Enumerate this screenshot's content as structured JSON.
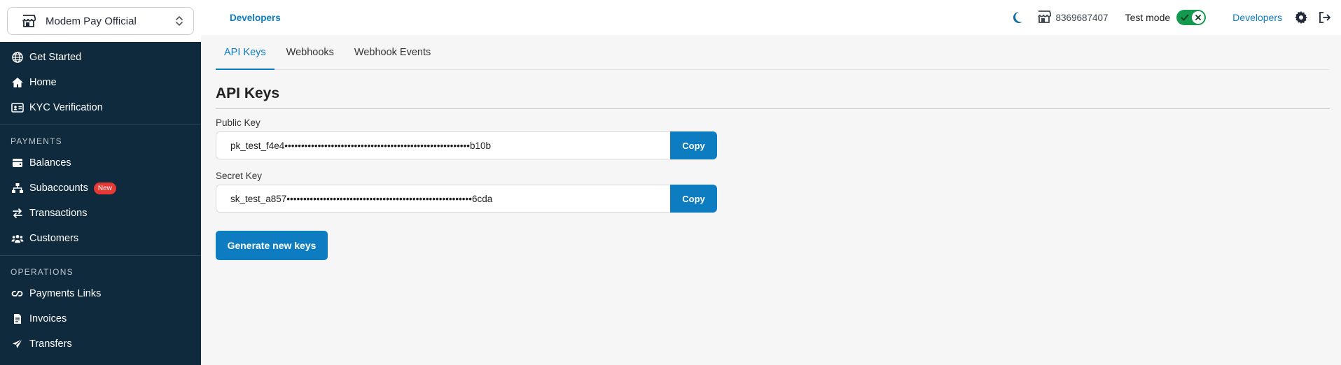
{
  "store": {
    "name": "Modem Pay Official"
  },
  "sidebar": {
    "top_items": [
      {
        "label": "Get Started",
        "icon": "globe-icon"
      },
      {
        "label": "Home",
        "icon": "home-icon"
      },
      {
        "label": "KYC Verification",
        "icon": "id-card-icon"
      }
    ],
    "payments_title": "PAYMENTS",
    "payments_items": [
      {
        "label": "Balances",
        "icon": "wallet-icon"
      },
      {
        "label": "Subaccounts",
        "icon": "sitemap-icon",
        "badge": "New"
      },
      {
        "label": "Transactions",
        "icon": "arrows-exchange-icon"
      },
      {
        "label": "Customers",
        "icon": "users-icon"
      }
    ],
    "operations_title": "OPERATIONS",
    "operations_items": [
      {
        "label": "Payments Links",
        "icon": "link-icon"
      },
      {
        "label": "Invoices",
        "icon": "invoice-icon"
      },
      {
        "label": "Transfers",
        "icon": "paper-plane-icon"
      }
    ]
  },
  "topbar": {
    "breadcrumb": "Developers",
    "phone": "8369687407",
    "test_mode_label": "Test mode",
    "test_mode_on": true,
    "developers_link": "Developers"
  },
  "tabs": [
    {
      "label": "API Keys",
      "active": true
    },
    {
      "label": "Webhooks",
      "active": false
    },
    {
      "label": "Webhook Events",
      "active": false
    }
  ],
  "api_keys": {
    "heading": "API Keys",
    "public_label": "Public Key",
    "public_value": "pk_test_f4e4••••••••••••••••••••••••••••••••••••••••••••••••••••••••b10b",
    "secret_label": "Secret Key",
    "secret_value": "sk_test_a857••••••••••••••••••••••••••••••••••••••••••••••••••••••••6cda",
    "copy_label": "Copy",
    "generate_label": "Generate new keys"
  },
  "colors": {
    "accent": "#0d7cc1",
    "sidebar_bg": "#0f2a3d",
    "toggle_on": "#149a4f",
    "badge": "#e53935"
  }
}
